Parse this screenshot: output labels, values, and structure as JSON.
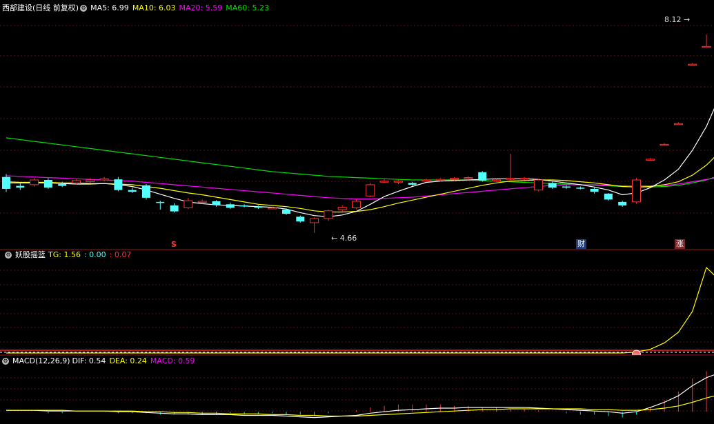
{
  "main_legend": {
    "title": "西部建设(日线 前复权)",
    "ma5": "MA5: 6.99",
    "ma10": "MA10: 6.03",
    "ma20": "MA20: 5.59",
    "ma60": "MA60: 5.23",
    "colors": {
      "ma5": "#ffffff",
      "ma10": "#ffff00",
      "ma20": "#ff00ff",
      "ma60": "#00e000",
      "up": "#ff3232",
      "down": "#54ffff"
    }
  },
  "high_label": "8.12",
  "low_label": "4.66",
  "markers": {
    "s": "S",
    "cai": "财",
    "zhang": "涨"
  },
  "indicator_legend": {
    "name": "妖股摇篮",
    "tg": "TG: 1.56",
    "v2": ": 0.00",
    "v3": ": 0.07"
  },
  "macd_legend": {
    "name": "MACD(12,26,9)",
    "dif": "DIF: 0.54",
    "dea": "DEA: 0.24",
    "macd": "MACD: 0.59"
  },
  "chart_data": {
    "type": "candlestick",
    "price_range": [
      4.4,
      8.35
    ],
    "candles": [
      [
        5.6,
        5.4,
        5.65,
        5.35
      ],
      [
        5.45,
        5.42,
        5.5,
        5.38
      ],
      [
        5.47,
        5.55,
        5.58,
        5.44
      ],
      [
        5.55,
        5.42,
        5.58,
        5.4
      ],
      [
        5.48,
        5.45,
        5.52,
        5.43
      ],
      [
        5.5,
        5.54,
        5.56,
        5.47
      ],
      [
        5.52,
        5.55,
        5.58,
        5.5
      ],
      [
        5.55,
        5.57,
        5.6,
        5.53
      ],
      [
        5.56,
        5.38,
        5.6,
        5.36
      ],
      [
        5.38,
        5.35,
        5.42,
        5.33
      ],
      [
        5.46,
        5.25,
        5.48,
        5.22
      ],
      [
        5.18,
        5.17,
        5.2,
        5.05
      ],
      [
        5.12,
        5.02,
        5.16,
        5.0
      ],
      [
        5.08,
        5.2,
        5.25,
        5.06
      ],
      [
        5.18,
        5.19,
        5.22,
        5.15
      ],
      [
        5.19,
        5.13,
        5.21,
        5.1
      ],
      [
        5.14,
        5.08,
        5.17,
        5.06
      ],
      [
        5.12,
        5.11,
        5.14,
        5.09
      ],
      [
        5.1,
        5.09,
        5.12,
        5.06
      ],
      [
        5.08,
        5.08,
        5.1,
        5.06
      ],
      [
        5.05,
        4.98,
        5.07,
        4.96
      ],
      [
        4.93,
        4.85,
        4.95,
        4.83
      ],
      [
        4.83,
        4.9,
        4.92,
        4.66
      ],
      [
        4.9,
        5.03,
        5.05,
        4.86
      ],
      [
        5.05,
        5.09,
        5.12,
        5.02
      ],
      [
        5.08,
        5.19,
        5.22,
        5.06
      ],
      [
        5.28,
        5.47,
        5.5,
        5.26
      ],
      [
        5.53,
        5.53,
        5.56,
        5.5
      ],
      [
        5.53,
        5.53,
        5.55,
        5.48
      ],
      [
        5.5,
        5.47,
        5.52,
        5.45
      ],
      [
        5.54,
        5.55,
        5.57,
        5.52
      ],
      [
        5.55,
        5.56,
        5.58,
        5.53
      ],
      [
        5.56,
        5.58,
        5.6,
        5.54
      ],
      [
        5.58,
        5.59,
        5.61,
        5.55
      ],
      [
        5.68,
        5.54,
        5.7,
        5.52
      ],
      [
        5.54,
        5.55,
        5.57,
        5.52
      ],
      [
        5.56,
        5.58,
        5.99,
        5.53
      ],
      [
        5.58,
        5.58,
        5.6,
        5.55
      ],
      [
        5.38,
        5.55,
        5.57,
        5.36
      ],
      [
        5.5,
        5.42,
        5.52,
        5.4
      ],
      [
        5.44,
        5.42,
        5.46,
        5.4
      ],
      [
        5.42,
        5.41,
        5.44,
        5.39
      ],
      [
        5.4,
        5.35,
        5.42,
        5.32
      ],
      [
        5.32,
        5.22,
        5.33,
        5.2
      ],
      [
        5.18,
        5.12,
        5.2,
        5.1
      ],
      [
        5.18,
        5.55,
        5.58,
        5.15
      ],
      [
        5.9,
        5.9,
        5.92,
        5.88
      ],
      [
        6.15,
        6.15,
        6.17,
        6.13
      ],
      [
        6.5,
        6.5,
        6.52,
        6.48
      ],
      [
        7.5,
        7.5,
        7.52,
        7.48
      ],
      [
        7.8,
        7.8,
        8.0,
        7.78
      ],
      [
        7.64,
        7.9,
        8.12,
        7.62
      ]
    ],
    "ma5": [
      5.5,
      5.5,
      5.5,
      5.5,
      5.49,
      5.48,
      5.48,
      5.49,
      5.47,
      5.44,
      5.38,
      5.31,
      5.24,
      5.18,
      5.15,
      5.13,
      5.12,
      5.11,
      5.1,
      5.09,
      5.06,
      5.0,
      4.95,
      4.93,
      4.96,
      5.02,
      5.14,
      5.27,
      5.36,
      5.44,
      5.51,
      5.53,
      5.54,
      5.55,
      5.56,
      5.57,
      5.57,
      5.57,
      5.56,
      5.53,
      5.5,
      5.47,
      5.43,
      5.38,
      5.3,
      5.33,
      5.42,
      5.55,
      5.73,
      6.05,
      6.45,
      6.99
    ],
    "ma10": [
      5.52,
      5.51,
      5.51,
      5.51,
      5.5,
      5.5,
      5.49,
      5.49,
      5.48,
      5.47,
      5.44,
      5.41,
      5.37,
      5.33,
      5.3,
      5.26,
      5.22,
      5.18,
      5.14,
      5.12,
      5.1,
      5.07,
      5.03,
      5.01,
      5.01,
      5.02,
      5.05,
      5.1,
      5.16,
      5.21,
      5.26,
      5.31,
      5.36,
      5.41,
      5.46,
      5.5,
      5.53,
      5.54,
      5.55,
      5.55,
      5.54,
      5.52,
      5.5,
      5.47,
      5.44,
      5.43,
      5.44,
      5.47,
      5.52,
      5.63,
      5.8,
      6.03
    ],
    "ma20": [
      5.62,
      5.61,
      5.6,
      5.59,
      5.58,
      5.57,
      5.56,
      5.55,
      5.54,
      5.53,
      5.51,
      5.49,
      5.47,
      5.45,
      5.43,
      5.41,
      5.39,
      5.37,
      5.35,
      5.33,
      5.31,
      5.29,
      5.27,
      5.25,
      5.24,
      5.23,
      5.23,
      5.24,
      5.25,
      5.26,
      5.28,
      5.3,
      5.32,
      5.34,
      5.36,
      5.38,
      5.4,
      5.42,
      5.44,
      5.46,
      5.47,
      5.47,
      5.47,
      5.46,
      5.45,
      5.45,
      5.45,
      5.46,
      5.48,
      5.52,
      5.56,
      5.59
    ],
    "ma60": [
      6.26,
      6.23,
      6.2,
      6.17,
      6.14,
      6.11,
      6.08,
      6.05,
      6.02,
      5.99,
      5.96,
      5.93,
      5.9,
      5.87,
      5.84,
      5.81,
      5.78,
      5.75,
      5.72,
      5.69,
      5.67,
      5.65,
      5.63,
      5.61,
      5.6,
      5.59,
      5.58,
      5.57,
      5.56,
      5.55,
      5.55,
      5.55,
      5.55,
      5.55,
      5.54,
      5.53,
      5.52,
      5.51,
      5.5,
      5.49,
      5.48,
      5.47,
      5.46,
      5.45,
      5.44,
      5.43,
      5.43,
      5.44,
      5.46,
      5.5,
      5.55,
      5.63
    ],
    "tg": [
      0,
      0,
      0,
      0,
      0,
      0,
      0,
      0,
      0,
      0,
      0,
      0,
      0,
      0,
      0,
      0,
      0,
      0,
      0,
      0,
      0,
      0,
      0,
      0,
      0,
      0,
      0,
      0,
      0,
      0,
      0,
      0,
      0,
      0,
      0,
      0,
      0,
      0,
      0,
      0,
      0,
      0,
      0,
      0,
      0,
      0.02,
      0.08,
      0.22,
      0.45,
      0.9,
      1.85,
      1.56
    ],
    "tg_range": [
      0,
      2.0
    ],
    "dif": [
      0.02,
      0.02,
      0.02,
      0.01,
      0.01,
      0.01,
      0.01,
      0.01,
      0.0,
      0.0,
      -0.01,
      -0.02,
      -0.03,
      -0.03,
      -0.04,
      -0.04,
      -0.04,
      -0.05,
      -0.05,
      -0.05,
      -0.06,
      -0.07,
      -0.08,
      -0.07,
      -0.06,
      -0.05,
      -0.02,
      0.0,
      0.02,
      0.03,
      0.04,
      0.05,
      0.05,
      0.06,
      0.06,
      0.06,
      0.06,
      0.06,
      0.05,
      0.04,
      0.03,
      0.02,
      0.01,
      0.0,
      -0.02,
      0.0,
      0.06,
      0.13,
      0.22,
      0.36,
      0.47,
      0.54
    ],
    "dea": [
      0.02,
      0.02,
      0.02,
      0.02,
      0.02,
      0.01,
      0.01,
      0.01,
      0.01,
      0.01,
      0.0,
      0.0,
      -0.01,
      -0.01,
      -0.02,
      -0.02,
      -0.03,
      -0.03,
      -0.03,
      -0.04,
      -0.04,
      -0.05,
      -0.05,
      -0.06,
      -0.06,
      -0.06,
      -0.05,
      -0.04,
      -0.03,
      -0.02,
      -0.01,
      0.0,
      0.01,
      0.02,
      0.03,
      0.03,
      0.04,
      0.04,
      0.04,
      0.04,
      0.04,
      0.04,
      0.03,
      0.03,
      0.02,
      0.02,
      0.03,
      0.05,
      0.08,
      0.13,
      0.19,
      0.24
    ],
    "macd_range": [
      -0.15,
      0.62
    ]
  }
}
